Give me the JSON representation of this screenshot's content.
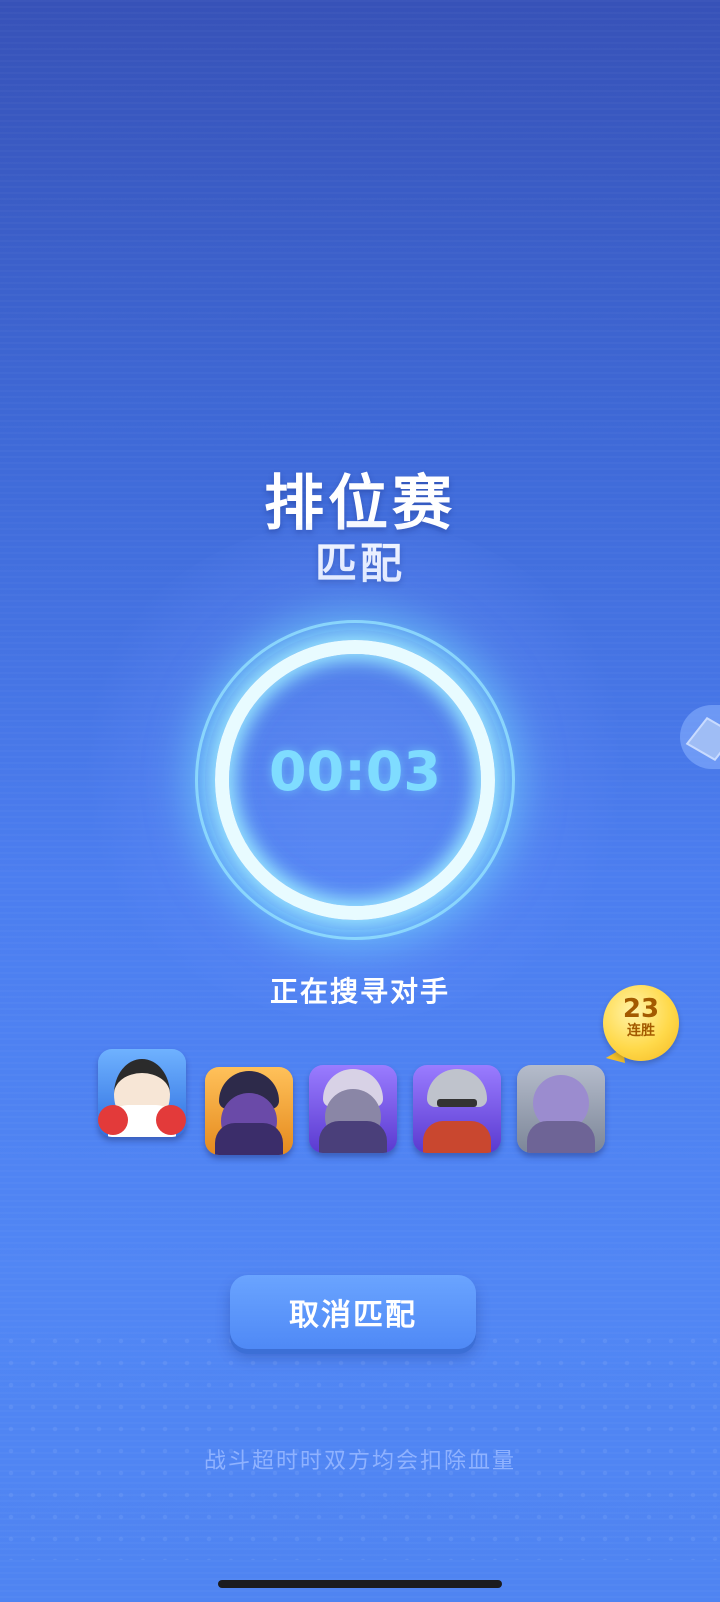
{
  "match": {
    "mode_title": "排位赛",
    "mode_subtitle": "匹配",
    "timer": "00:03",
    "status": "正在搜寻对手"
  },
  "streak": {
    "count": "23",
    "label": "连胜"
  },
  "heroes": [
    {
      "name": "hero-girl-pompom",
      "frame_color": "#3f86f0"
    },
    {
      "name": "hero-horned-mage",
      "frame_color": "#f0a23a"
    },
    {
      "name": "hero-armored-knight",
      "frame_color": "#7a5ae8"
    },
    {
      "name": "hero-helmet-soldier",
      "frame_color": "#7a5ae8"
    },
    {
      "name": "hero-purple-ghoul",
      "frame_color": "#8a96aa"
    }
  ],
  "actions": {
    "cancel_label": "取消匹配"
  },
  "footer": {
    "notice": "战斗超时时双方均会扣除血量"
  },
  "colors": {
    "timer": "#7fdcff",
    "ring": "#e8fbff",
    "streak_badge": "#ffd94a",
    "button": "#5a95fa"
  }
}
